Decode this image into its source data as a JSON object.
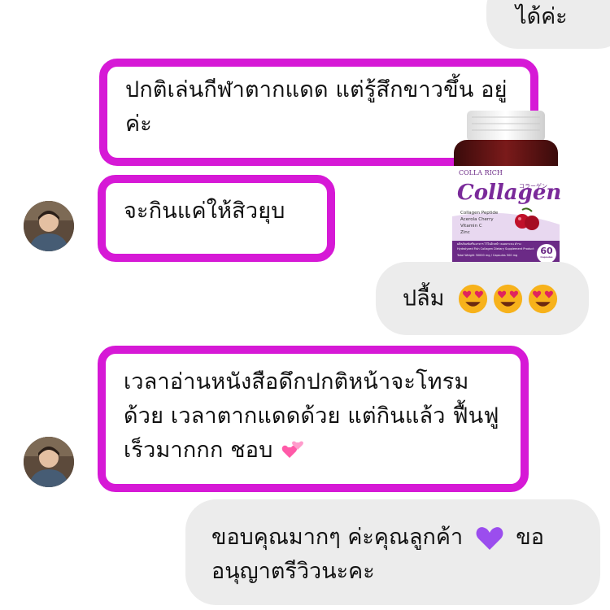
{
  "chat": {
    "outgoing_top": "ได้ค่ะ",
    "msg1": "ปกติเล่นกีฬาตากแดด แต่รู้สึกขาวขึ้น อยู่ค่ะ",
    "msg2": "จะกินแค่ให้สิวยุบ",
    "msg3_text": "ปลื้ม",
    "msg4": "เวลาอ่านหนังสือดึกปกติหน้าจะโทรม ด้วย เวลาตากแดดด้วย แต่กินแล้ว ฟื้นฟูเร็วมากกก ชอบ",
    "reply": "ขอบคุณมากๆ ค่ะคุณลูกค้า ขออนุญาตรีวิวนะคะ",
    "reply_line1_a": "ขอบคุณมากๆ ค่ะคุณลูกค้า",
    "reply_line1_b": "ขอ",
    "reply_line2": "อนุญาตรีวิวนะคะ"
  },
  "product": {
    "brand": "COLLA RICH",
    "name": "Collagen",
    "jp": "コラーゲン",
    "features": [
      "Collagen Peptide",
      "Acerola Cherry",
      "Vitamin C",
      "Zinc"
    ],
    "count": "60",
    "count_unit": "Capsules",
    "info_line1": "ผลิตภัณฑ์เสริมอาหาร ไว้ในผิวหน้า คอลลาเจน ดำรง",
    "info_line2": "Hydrolyzed Fish Collagen Dietary Supplement Product",
    "info_line3": "Total Weight 30000 mg / Capsules 500 mg"
  },
  "icons": {
    "emoji_reaction": "heart-eyes-emoji",
    "emoji_love": "two-hearts-emoji",
    "emoji_purple": "purple-heart-emoji"
  },
  "colors": {
    "highlight": "#d619d6",
    "bubble_out": "#ececec",
    "purple_heart": "#8e44ec"
  }
}
